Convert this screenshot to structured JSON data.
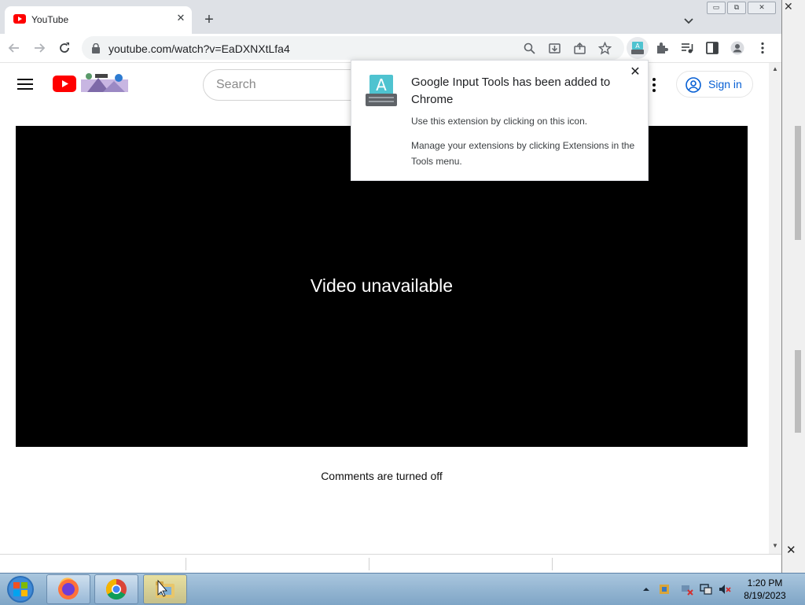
{
  "browser": {
    "tab": {
      "title": "YouTube",
      "close_glyph": "✕"
    },
    "new_tab_glyph": "+",
    "window_controls": {
      "minimize": "▭",
      "restore": "⧉",
      "close": "✕"
    },
    "address": {
      "url": "youtube.com/watch?v=EaDXNXtLfa4"
    },
    "icons": [
      "back-icon",
      "forward-icon",
      "reload-icon",
      "lock-icon",
      "zoom-icon",
      "install-icon",
      "share-icon",
      "bookmark-star-icon",
      "google-input-tools-icon",
      "extensions-puzzle-icon",
      "media-queue-icon",
      "side-panel-icon",
      "profile-icon",
      "menu-kebab-icon"
    ]
  },
  "youtube": {
    "search_placeholder": "Search",
    "sign_in_label": "Sign in",
    "player_message": "Video unavailable",
    "comments_message": "Comments are turned off",
    "brand_color": "#ff0000",
    "link_color": "#065fd4"
  },
  "popup": {
    "title": "Google Input Tools has been added to Chrome",
    "line1": "Use this extension by clicking on this icon.",
    "line2": "Manage your extensions by clicking Extensions in the Tools menu.",
    "close_glyph": "✕"
  },
  "taskbar": {
    "apps": [
      "firefox-icon",
      "chrome-icon",
      "file-manager-icon"
    ],
    "clock_time": "1:20 PM",
    "clock_date": "8/19/2023"
  }
}
